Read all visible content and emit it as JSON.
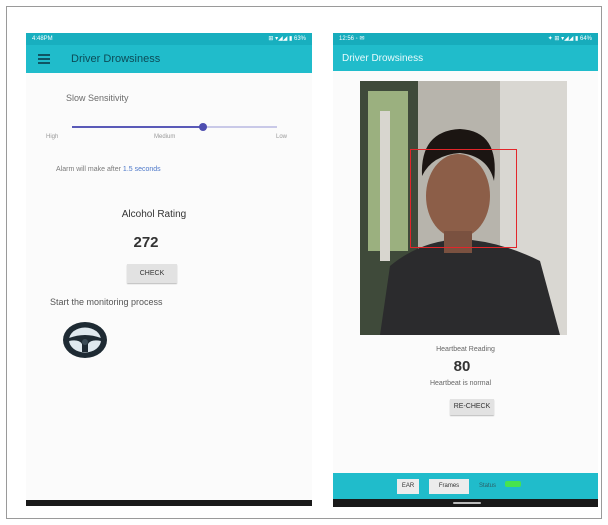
{
  "left_screen": {
    "status_time": "4:48PM",
    "status_icons": "⊞ ▾◢◢ ▮ 63%",
    "app_title": "Driver Drowsiness",
    "sensitivity_label": "Slow Sensitivity",
    "slider": {
      "ticks": [
        "High",
        "Medium",
        "Low"
      ],
      "value_fraction": 0.64
    },
    "alarm_prefix": "Alarm will make after",
    "alarm_value": "1.5 seconds",
    "alcohol_label": "Alcohol Rating",
    "alcohol_value": "272",
    "check_label": "CHECK",
    "start_label": "Start the monitoring process",
    "wheel_icon": "steering-wheel-icon"
  },
  "right_screen": {
    "status_time": "12:56 ◦ ✉",
    "status_icons": "✦ ⊞ ▾◢◢ ▮ 64%",
    "app_title": "Driver Drowsiness",
    "heart_label": "Heartbeat Reading",
    "heart_value": "80",
    "heart_status": "Heartbeat is normal",
    "recheck_label": "RE-CHECK",
    "bottom": {
      "btn1": "EAR",
      "btn2": "Frames",
      "status_label": "Status"
    }
  },
  "colors": {
    "appbar": "#20bccb",
    "slider": "#5a5ab8",
    "face_box": "#e2262a",
    "status_ok": "#47e34f"
  }
}
